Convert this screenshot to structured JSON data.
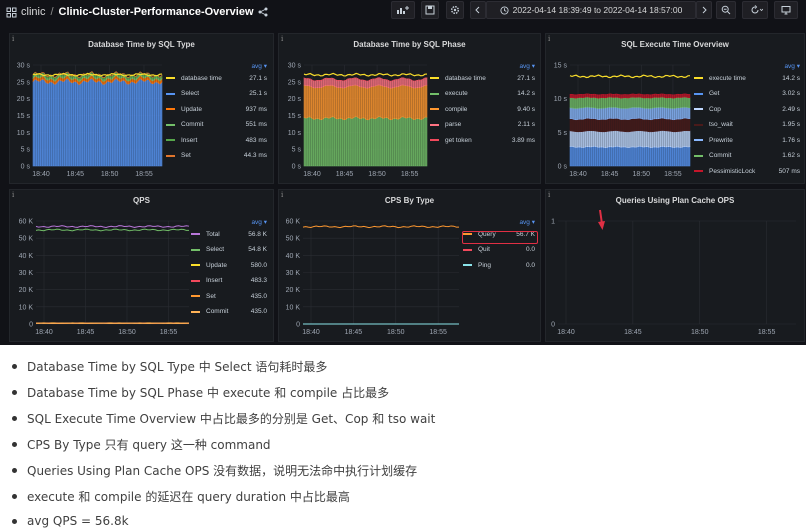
{
  "header": {
    "app": "clinic",
    "separator": "/",
    "dashboard_title": "Clinic-Cluster-Performance-Overview",
    "time_range": "2022-04-14 18:39:49 to 2022-04-14 18:57:00"
  },
  "panels": [
    {
      "title": "Database Time by SQL Type",
      "chart_data": {
        "type": "area",
        "stacked": true,
        "xlabels": [
          "18:40",
          "18:45",
          "18:50",
          "18:55"
        ],
        "ylabels": [
          "0 s",
          "5 s",
          "10 s",
          "15 s",
          "20 s",
          "25 s",
          "30 s"
        ],
        "ylim": [
          0,
          30
        ],
        "series": [
          {
            "name": "database time",
            "color": "#fade2a",
            "avg": "27.1 s",
            "value": 27.1,
            "line": true
          },
          {
            "name": "Select",
            "color": "#5794f2",
            "avg": "25.1 s",
            "value": 25.1
          },
          {
            "name": "Update",
            "color": "#ff780a",
            "avg": "937 ms",
            "value": 0.937
          },
          {
            "name": "Commit",
            "color": "#73bf69",
            "avg": "551 ms",
            "value": 0.551
          },
          {
            "name": "Insert",
            "color": "#56a64b",
            "avg": "483 ms",
            "value": 0.483
          },
          {
            "name": "Set",
            "color": "#e0752d",
            "avg": "44.3 ms",
            "value": 0.0443
          }
        ]
      }
    },
    {
      "title": "Database Time by SQL Phase",
      "chart_data": {
        "type": "area",
        "stacked": true,
        "xlabels": [
          "18:40",
          "18:45",
          "18:50",
          "18:55"
        ],
        "ylabels": [
          "0 s",
          "5 s",
          "10 s",
          "15 s",
          "20 s",
          "25 s",
          "30 s"
        ],
        "ylim": [
          0,
          30
        ],
        "series": [
          {
            "name": "database time",
            "color": "#fade2a",
            "avg": "27.1 s",
            "value": 27.1,
            "line": true
          },
          {
            "name": "execute",
            "color": "#73bf69",
            "avg": "14.2 s",
            "value": 14.2
          },
          {
            "name": "compile",
            "color": "#ff9830",
            "avg": "9.40 s",
            "value": 9.4
          },
          {
            "name": "parse",
            "color": "#ff7383",
            "avg": "2.11 s",
            "value": 2.11
          },
          {
            "name": "get token",
            "color": "#f2495c",
            "avg": "3.89 ms",
            "value": 0.00389
          }
        ]
      }
    },
    {
      "title": "SQL Execute Time Overview",
      "chart_data": {
        "type": "area",
        "stacked": true,
        "xlabels": [
          "18:40",
          "18:45",
          "18:50",
          "18:55"
        ],
        "ylabels": [
          "0 s",
          "5 s",
          "10 s",
          "15 s"
        ],
        "ylim": [
          0,
          16
        ],
        "series": [
          {
            "name": "execute time",
            "color": "#fade2a",
            "avg": "14.2 s",
            "value": 14.2,
            "line": true
          },
          {
            "name": "Get",
            "color": "#5794f2",
            "avg": "3.02 s",
            "value": 3.02
          },
          {
            "name": "Cop",
            "color": "#c0d8ff",
            "avg": "2.49 s",
            "value": 2.49
          },
          {
            "name": "tso_wait",
            "color": "#4a1a1a",
            "avg": "1.95 s",
            "value": 1.95
          },
          {
            "name": "Prewrite",
            "color": "#8ab8ff",
            "avg": "1.76 s",
            "value": 1.76
          },
          {
            "name": "Commit",
            "color": "#73bf69",
            "avg": "1.62 s",
            "value": 1.62
          },
          {
            "name": "PessimisticLock",
            "color": "#c4162a",
            "avg": "507 ms",
            "value": 0.507
          }
        ]
      }
    },
    {
      "title": "QPS",
      "chart_data": {
        "type": "line",
        "xlabels": [
          "18:40",
          "18:45",
          "18:50",
          "18:55"
        ],
        "ylabels": [
          "0",
          "10 K",
          "20 K",
          "30 K",
          "40 K",
          "50 K",
          "60 K"
        ],
        "ylim": [
          0,
          60000
        ],
        "series": [
          {
            "name": "Total",
            "color": "#b877d9",
            "avg": "56.8 K",
            "value": 56800
          },
          {
            "name": "Select",
            "color": "#73bf69",
            "avg": "54.8 K",
            "value": 54800
          },
          {
            "name": "Update",
            "color": "#fade2a",
            "avg": "580.0",
            "value": 580
          },
          {
            "name": "Insert",
            "color": "#f2495c",
            "avg": "483.3",
            "value": 483.3
          },
          {
            "name": "Set",
            "color": "#ff9830",
            "avg": "435.0",
            "value": 435
          },
          {
            "name": "Commit",
            "color": "#ffb357",
            "avg": "435.0",
            "value": 435
          }
        ]
      }
    },
    {
      "title": "CPS By Type",
      "chart_data": {
        "type": "line",
        "xlabels": [
          "18:40",
          "18:45",
          "18:50",
          "18:55"
        ],
        "ylabels": [
          "0",
          "10 K",
          "20 K",
          "30 K",
          "40 K",
          "50 K",
          "60 K"
        ],
        "ylim": [
          0,
          60000
        ],
        "series": [
          {
            "name": "Query",
            "color": "#ff9830",
            "avg": "56.7 K",
            "value": 56700
          },
          {
            "name": "Quit",
            "color": "#f2495c",
            "avg": "0.0",
            "value": 0
          },
          {
            "name": "Ping",
            "color": "#8ae4ea",
            "avg": "0.0",
            "value": 0
          }
        ]
      }
    },
    {
      "title": "Queries Using Plan Cache OPS",
      "chart_data": {
        "type": "line",
        "xlabels": [
          "18:40",
          "18:45",
          "18:50",
          "18:55"
        ],
        "ylabels": [
          "0",
          "1"
        ],
        "ylim": [
          0,
          1
        ],
        "series": []
      }
    }
  ],
  "legend_header": "avg",
  "notes": [
    "Database Time by SQL Type 中 Select 语句耗时最多",
    "Database Time by SQL Phase 中 execute 和 compile 占比最多",
    "SQL Execute Time Overview 中占比最多的分别是 Get、Cop 和 tso wait",
    "CPS By Type 只有 query 这一种 command",
    "Queries Using Plan Cache OPS 没有数据，说明无法命中执行计划缓存",
    "execute 和 compile 的延迟在 query duration 中占比最高",
    "avg QPS = 56.8k"
  ]
}
